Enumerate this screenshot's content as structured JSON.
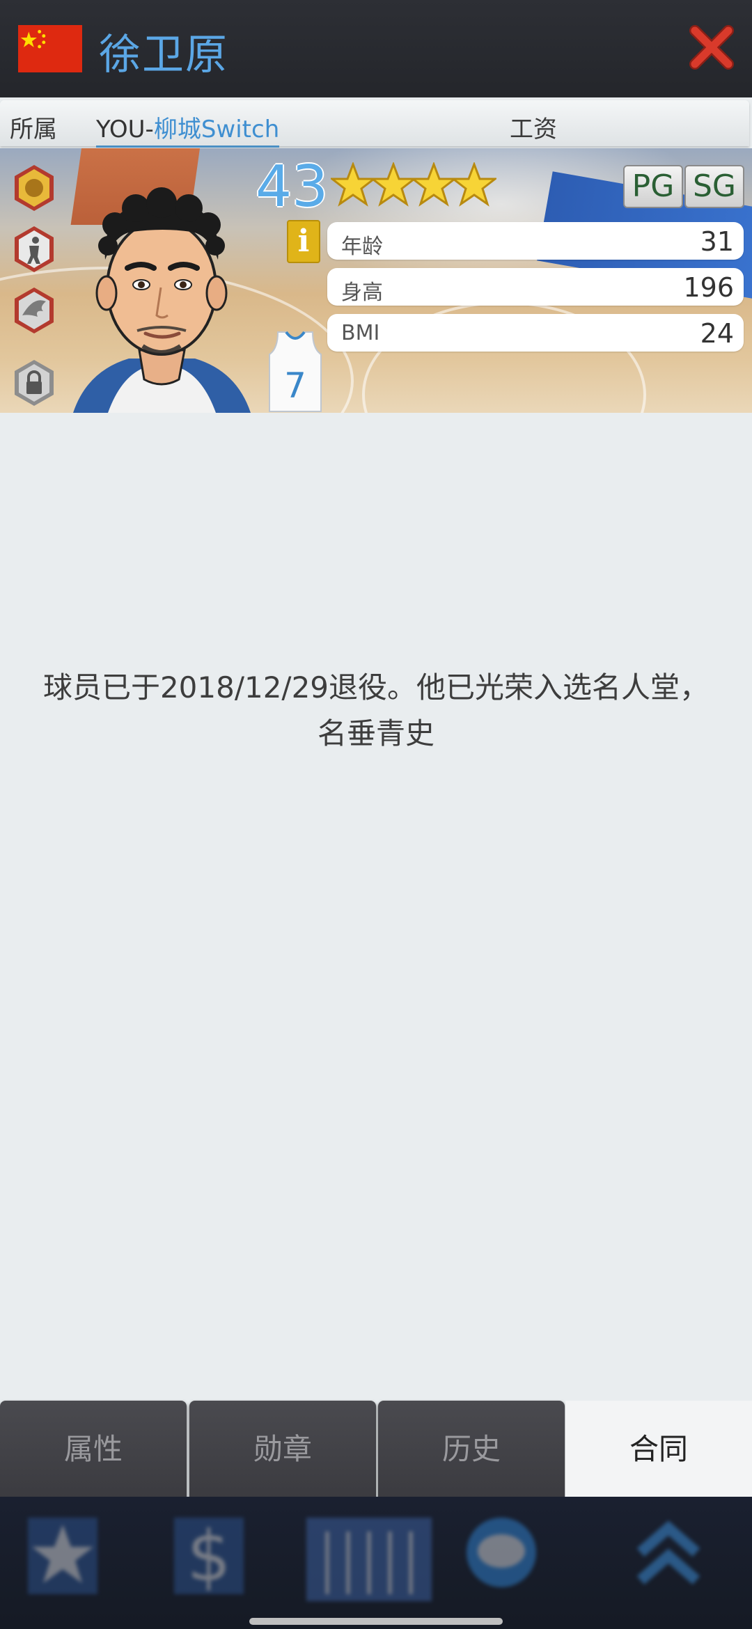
{
  "header": {
    "flag_icon": "china-flag-icon",
    "player_name": "徐卫原",
    "close_icon": "close-x-icon",
    "colors": {
      "name": "#5ba7e6",
      "close": "#d93a2b",
      "flag": "#de2910"
    }
  },
  "infobar": {
    "affiliation_label": "所属",
    "team_prefix": "YOU-",
    "team_name": "柳城Switch",
    "salary_label": "工资"
  },
  "player": {
    "overall": "43",
    "stars": 4,
    "positions": [
      "PG",
      "SG"
    ],
    "jersey_number": "7",
    "info_icon": "info-icon",
    "stats": [
      {
        "label": "年龄",
        "value": "31"
      },
      {
        "label": "身高",
        "value": "196"
      },
      {
        "label": "BMI",
        "value": "24"
      }
    ],
    "badges": [
      "gold-hand-badge-icon",
      "player-silhouette-badge-icon",
      "wing-badge-icon",
      "lock-badge-icon"
    ]
  },
  "message": {
    "line1": "球员已于2018/12/29退役。他已光荣入选名人堂，",
    "line2": "名垂青史"
  },
  "tabs": [
    {
      "label": "属性",
      "active": false
    },
    {
      "label": "勋章",
      "active": false
    },
    {
      "label": "历史",
      "active": false
    },
    {
      "label": "合同",
      "active": true
    }
  ],
  "bottom_nav": [
    "star-icon",
    "dollar-icon",
    "arena-icon",
    "chat-icon",
    "chevron-up-icon"
  ]
}
